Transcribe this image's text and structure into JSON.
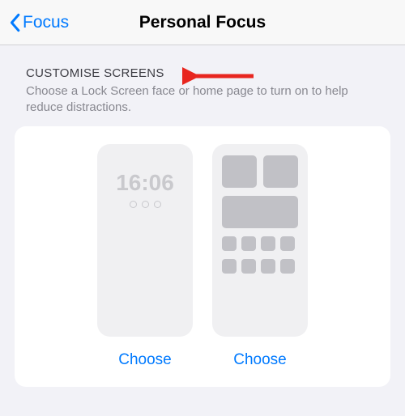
{
  "navbar": {
    "back_label": "Focus",
    "title": "Personal Focus"
  },
  "section": {
    "header": "CUSTOMISE SCREENS",
    "sub": "Choose a Lock Screen face or home page to turn on to help reduce distractions."
  },
  "lock_screen": {
    "time": "16:06",
    "choose_label": "Choose"
  },
  "home_screen": {
    "choose_label": "Choose"
  }
}
